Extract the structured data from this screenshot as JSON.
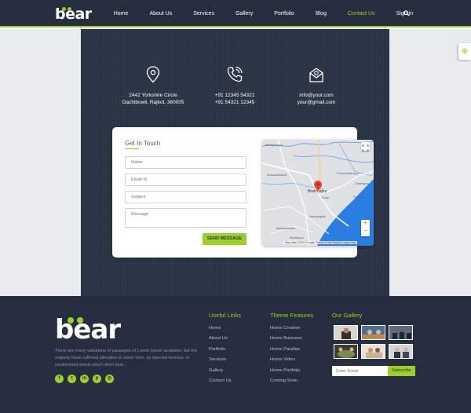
{
  "header": {
    "logo": "bear",
    "nav": [
      "Home",
      "About Us",
      "Services",
      "Gallery",
      "Portfolio",
      "Blog",
      "Contact Us",
      "Sign in"
    ],
    "active_nav": "Contact Us",
    "search_icon": "search-icon"
  },
  "side_tab": {
    "icon": "gear-icon"
  },
  "contact_info": {
    "address": {
      "icon": "location-pin-icon",
      "line1": "2442 Yorkshire Circle",
      "line2": "Gachibowli, Rajkot, 360005"
    },
    "phone": {
      "icon": "phone-icon",
      "line1": "+91 12345 54321",
      "line2": "+91 54321 12345"
    },
    "email": {
      "icon": "envelope-icon",
      "line1": "info@your.com",
      "line2": "your@gmail.com"
    }
  },
  "form": {
    "title": "Get In Touch",
    "name_placeholder": "Name",
    "email_placeholder": "Email Id",
    "subject_placeholder": "Subject",
    "message_placeholder": "Message",
    "submit_label": "SEND MESSAGE"
  },
  "map": {
    "city_label": "Brahmapur",
    "places": [
      "Kukudakhandi",
      "Purushottampur",
      "Chatrapur",
      "Kulla",
      "Gopalpur",
      "Sakrampalli",
      "Mathabandha",
      "Madhupur",
      "Bhanjanagar"
    ],
    "footer_text": "Map data ©2023 Google   Terms of Use   Report a map error",
    "zoom_in": "+",
    "zoom_out": "−",
    "colors": {
      "land": "#dfe1e4",
      "water": "#2a7de1",
      "road": "#ffffff",
      "pin": "#ea4335"
    }
  },
  "footer": {
    "logo": "bear",
    "description": "There are many variations of passages of Lorem Ipsum available, but the majority have suffered alteration in some form, by injected humour, or randomised words which don't look...",
    "social": [
      {
        "icon": "facebook-icon",
        "glyph": "f"
      },
      {
        "icon": "twitter-icon",
        "glyph": "t"
      },
      {
        "icon": "linkedin-icon",
        "glyph": "in"
      },
      {
        "icon": "pinterest-icon",
        "glyph": "p"
      },
      {
        "icon": "instagram-icon",
        "glyph": "◎"
      }
    ],
    "useful_links": {
      "heading": "Useful Links",
      "items": [
        "Home",
        "About Us",
        "Portfolio",
        "Services",
        "Gallery",
        "Contact Us"
      ]
    },
    "theme_features": {
      "heading": "Theme Features",
      "items": [
        "Home Creative",
        "Home Business",
        "Home Parallax",
        "Home Video",
        "Home Portfolio",
        "Coming Soon"
      ]
    },
    "gallery": {
      "heading": "Our Gallery",
      "thumb_count": 6
    },
    "newsletter": {
      "placeholder": "Enter Email",
      "button": "Subscribe"
    }
  },
  "colors": {
    "accent": "#9ccf2a",
    "dark": "#252d3e",
    "panel": "#2b3445",
    "page_bg": "#e9ecef"
  }
}
